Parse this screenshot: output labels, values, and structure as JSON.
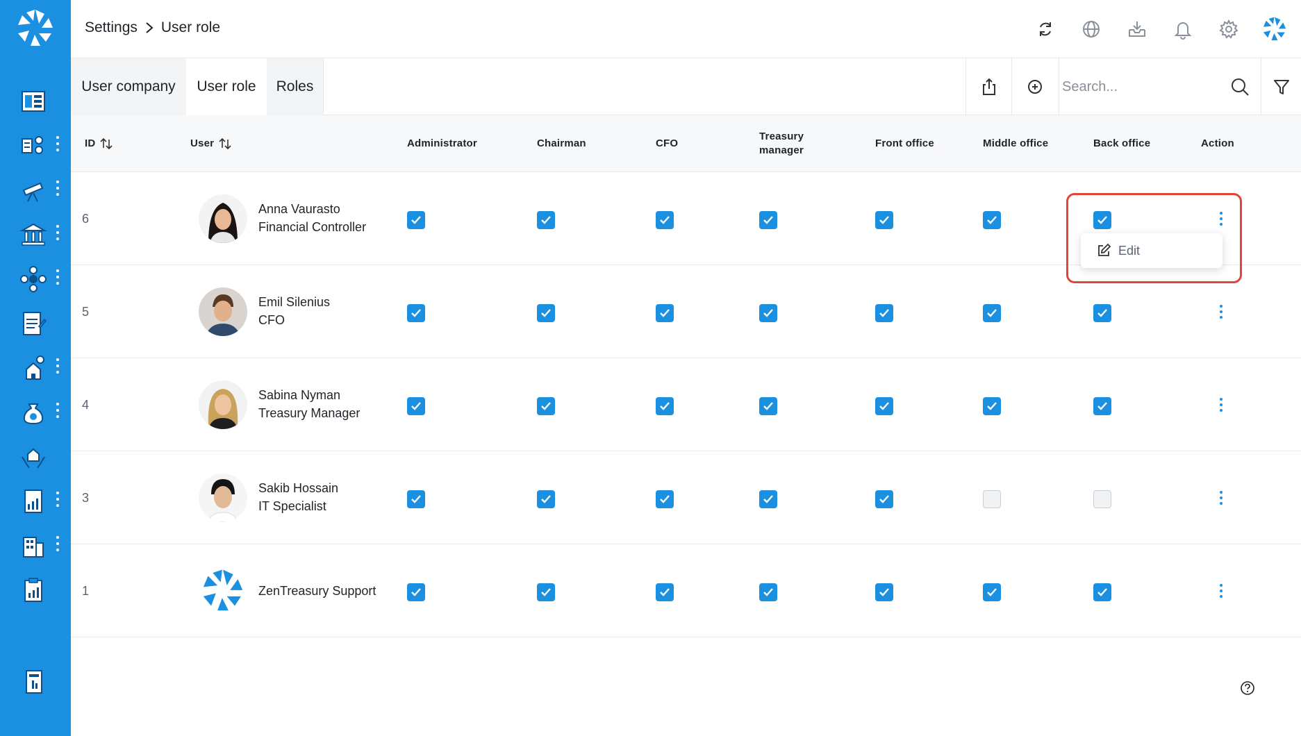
{
  "breadcrumb": {
    "parent": "Settings",
    "current": "User role"
  },
  "tabs": [
    {
      "label": "User company"
    },
    {
      "label": "User role"
    },
    {
      "label": "Roles"
    }
  ],
  "search": {
    "placeholder": "Search..."
  },
  "columns": {
    "id": "ID",
    "user": "User",
    "administrator": "Administrator",
    "chairman": "Chairman",
    "cfo": "CFO",
    "treasury_manager_1": "Treasury",
    "treasury_manager_2": "manager",
    "front_office": "Front office",
    "middle_office": "Middle office",
    "back_office": "Back office",
    "action": "Action"
  },
  "rows": [
    {
      "id": "6",
      "name": "Anna Vaurasto",
      "title": "Financial Controller",
      "roles": [
        true,
        true,
        true,
        true,
        true,
        true,
        true
      ]
    },
    {
      "id": "5",
      "name": "Emil Silenius",
      "title": "CFO",
      "roles": [
        true,
        true,
        true,
        true,
        true,
        true,
        true
      ]
    },
    {
      "id": "4",
      "name": "Sabina Nyman",
      "title": "Treasury Manager",
      "roles": [
        true,
        true,
        true,
        true,
        true,
        true,
        true
      ]
    },
    {
      "id": "3",
      "name": "Sakib Hossain",
      "title": "IT Specialist",
      "roles": [
        true,
        true,
        true,
        true,
        true,
        false,
        false
      ]
    },
    {
      "id": "1",
      "name": "ZenTreasury Support",
      "title": "",
      "roles": [
        true,
        true,
        true,
        true,
        true,
        true,
        true
      ]
    }
  ],
  "action_menu": {
    "edit_label": "Edit"
  },
  "colors": {
    "brand": "#1b8fe0",
    "highlight": "#e0443a"
  }
}
